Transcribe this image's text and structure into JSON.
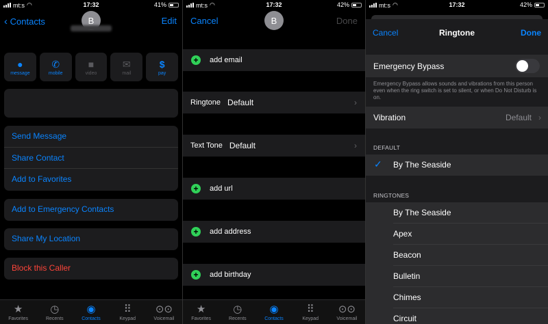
{
  "screens": {
    "contact_card": {
      "status": {
        "carrier": "mt:s",
        "time": "17:32",
        "battery": "41%"
      },
      "back_label": "Contacts",
      "edit_label": "Edit",
      "avatar_initial": "B",
      "actions": [
        {
          "icon": "message-icon",
          "label": "message",
          "enabled": true
        },
        {
          "icon": "phone-icon",
          "label": "mobile",
          "enabled": true
        },
        {
          "icon": "video-icon",
          "label": "video",
          "enabled": false
        },
        {
          "icon": "mail-icon",
          "label": "mail",
          "enabled": false
        },
        {
          "icon": "dollar-icon",
          "label": "pay",
          "enabled": true
        }
      ],
      "group1": [
        "Send Message",
        "Share Contact",
        "Add to Favorites"
      ],
      "emergency": "Add to Emergency Contacts",
      "share_location": "Share My Location",
      "block": "Block this Caller"
    },
    "edit_contact": {
      "status": {
        "carrier": "mt:s",
        "time": "17:32",
        "battery": "42%"
      },
      "cancel_label": "Cancel",
      "done_label": "Done",
      "avatar_initial": "B",
      "add_email": "add email",
      "ringtone": {
        "key": "Ringtone",
        "value": "Default"
      },
      "text_tone": {
        "key": "Text Tone",
        "value": "Default"
      },
      "add_url": "add url",
      "add_address": "add address",
      "add_birthday": "add birthday"
    },
    "ringtone_picker": {
      "status": {
        "carrier": "mt:s",
        "time": "17:32",
        "battery": "42%"
      },
      "cancel_label": "Cancel",
      "title": "Ringtone",
      "done_label": "Done",
      "emergency_bypass": "Emergency Bypass",
      "emergency_bypass_on": false,
      "emergency_note": "Emergency Bypass allows sounds and vibrations from this person even when the ring switch is set to silent, or when Do Not Disturb is on.",
      "vibration": {
        "label": "Vibration",
        "value": "Default"
      },
      "default_header": "DEFAULT",
      "default_tone": "By The Seaside",
      "ringtones_header": "RINGTONES",
      "ringtones": [
        "By The Seaside",
        "Apex",
        "Beacon",
        "Bulletin",
        "Chimes",
        "Circuit"
      ]
    }
  },
  "tabbar": [
    {
      "icon": "star-icon",
      "glyph": "★",
      "label": "Favorites"
    },
    {
      "icon": "clock-icon",
      "glyph": "◷",
      "label": "Recents"
    },
    {
      "icon": "person-icon",
      "glyph": "◉",
      "label": "Contacts"
    },
    {
      "icon": "keypad-icon",
      "glyph": "⠿",
      "label": "Keypad"
    },
    {
      "icon": "voicemail-icon",
      "glyph": "⊙⊙",
      "label": "Voicemail"
    }
  ],
  "colors": {
    "accent": "#0a84ff",
    "destructive": "#ff453a",
    "add": "#30d158"
  }
}
